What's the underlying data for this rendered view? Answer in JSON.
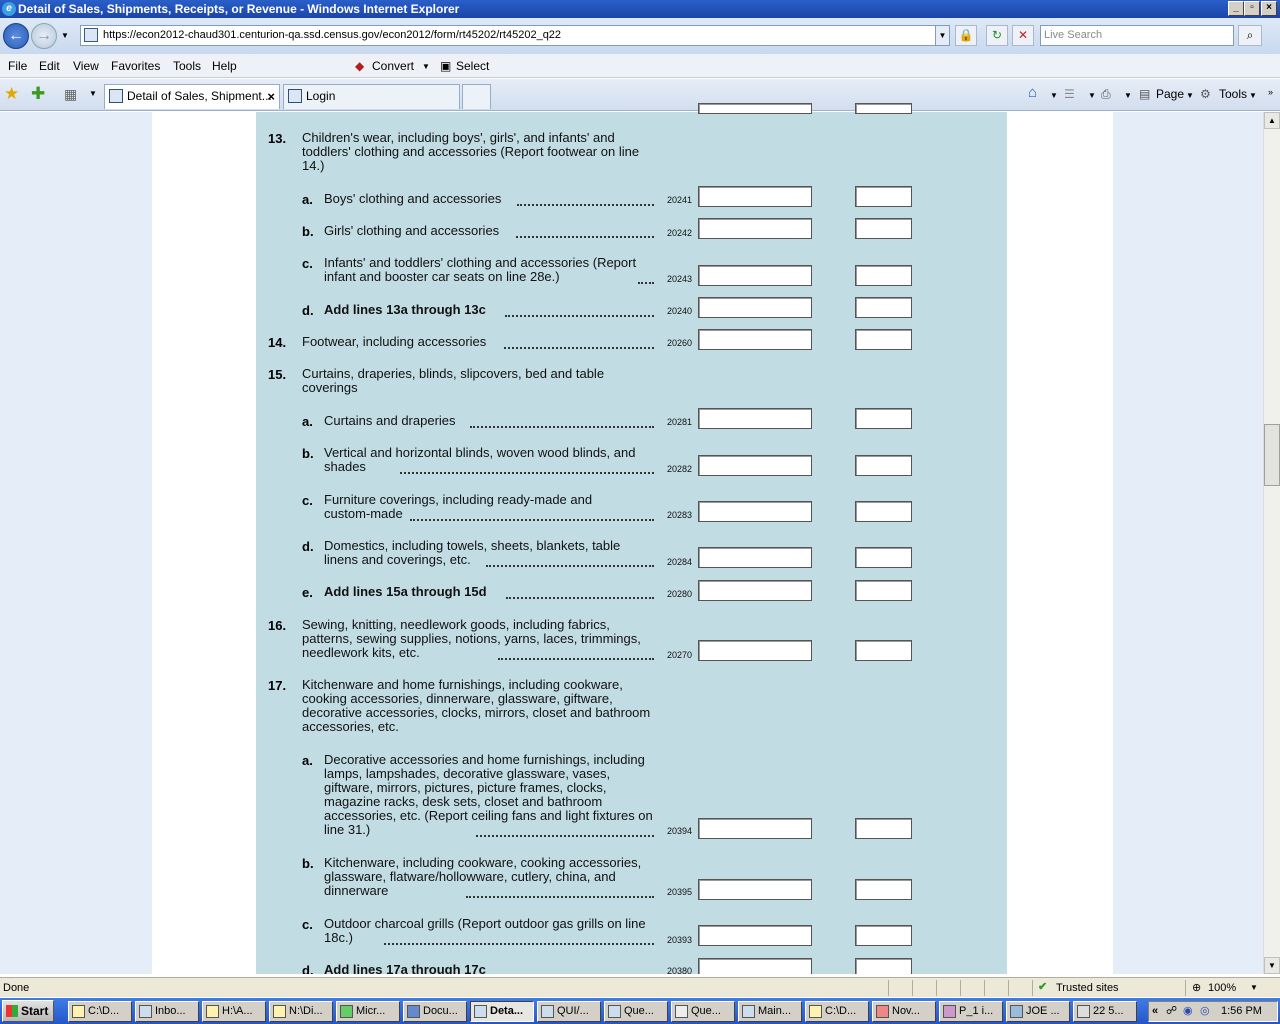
{
  "window": {
    "title": "Detail of Sales, Shipments, Receipts, or Revenue - Windows Internet Explorer"
  },
  "address": {
    "url": "https://econ2012-chaud301.centurion-qa.ssd.census.gov/econ2012/form/rt45202/rt45202_q22",
    "search_placeholder": "Live Search"
  },
  "menu": {
    "items": [
      "File",
      "Edit",
      "View",
      "Favorites",
      "Tools",
      "Help"
    ],
    "convert": "Convert",
    "select": "Select"
  },
  "tabs": [
    {
      "label": "Detail of Sales, Shipment..."
    },
    {
      "label": "Login"
    }
  ],
  "commands": {
    "page": "Page",
    "tools": "Tools"
  },
  "form": {
    "rows": [
      {
        "num": "13.",
        "text": "Children's wear, including boys', girls', and infants' and toddlers' clothing and accessories (Report footwear on line 14.)",
        "code": "",
        "bold": false
      },
      {
        "letter": "a.",
        "text": "Boys' clothing and accessories",
        "code": "20241"
      },
      {
        "letter": "b.",
        "text": "Girls' clothing and accessories",
        "code": "20242"
      },
      {
        "letter": "c.",
        "text": "Infants' and toddlers' clothing and accessories (Report infant and booster car seats on line 28e.)",
        "code": "20243"
      },
      {
        "letter": "d.",
        "text": "Add lines 13a through 13c",
        "code": "20240",
        "bold": true
      },
      {
        "num": "14.",
        "text": "Footwear, including accessories",
        "code": "20260"
      },
      {
        "num": "15.",
        "text": "Curtains, draperies, blinds, slipcovers, bed and table coverings",
        "code": ""
      },
      {
        "letter": "a.",
        "text": "Curtains and draperies",
        "code": "20281"
      },
      {
        "letter": "b.",
        "text": "Vertical and horizontal blinds, woven wood blinds, and shades",
        "code": "20282"
      },
      {
        "letter": "c.",
        "text": "Furniture coverings, including ready-made and custom-made",
        "code": "20283"
      },
      {
        "letter": "d.",
        "text": "Domestics, including towels, sheets, blankets, table linens and coverings, etc.",
        "code": "20284"
      },
      {
        "letter": "e.",
        "text": "Add lines 15a through 15d",
        "code": "20280",
        "bold": true
      },
      {
        "num": "16.",
        "text": "Sewing, knitting, needlework goods, including fabrics, patterns, sewing supplies, notions, yarns, laces, trimmings, needlework kits, etc.",
        "code": "20270"
      },
      {
        "num": "17.",
        "text": "Kitchenware and home furnishings, including cookware, cooking accessories, dinnerware, glassware, giftware, decorative accessories, clocks, mirrors, closet and bathroom accessories, etc.",
        "code": ""
      },
      {
        "letter": "a.",
        "text": "Decorative accessories and home furnishings, including lamps, lampshades, decorative glassware, vases, giftware, mirrors, pictures, picture frames, clocks, magazine racks, desk sets, closet and bathroom accessories, etc. (Report ceiling fans and light fixtures on line 31.)",
        "code": "20394"
      },
      {
        "letter": "b.",
        "text": "Kitchenware, including cookware, cooking accessories, glassware, flatware/hollowware, cutlery, china, and dinnerware",
        "code": "20395"
      },
      {
        "letter": "c.",
        "text": "Outdoor charcoal grills (Report outdoor gas grills on line 18c.)",
        "code": "20393"
      },
      {
        "letter": "d.",
        "text": "Add lines 17a through 17c",
        "code": "20380",
        "bold": true
      }
    ]
  },
  "status": {
    "text": "Done",
    "zone": "Trusted sites",
    "zoom": "100%"
  },
  "taskbar": {
    "start": "Start",
    "items": [
      "C:\\D...",
      "Inbo...",
      "H:\\A...",
      "N:\\Di...",
      "Micr...",
      "Docu...",
      "Deta...",
      "QUI/...",
      "Que...",
      "Que...",
      "Main...",
      "C:\\D...",
      "Nov...",
      "P_1 i...",
      "JOE ...",
      "22 5..."
    ],
    "clock": "1:56 PM"
  },
  "colors": {
    "form_bg": "#c2dce4",
    "page_bg": "#e5eef8",
    "title_bar": "#1b45a8"
  }
}
